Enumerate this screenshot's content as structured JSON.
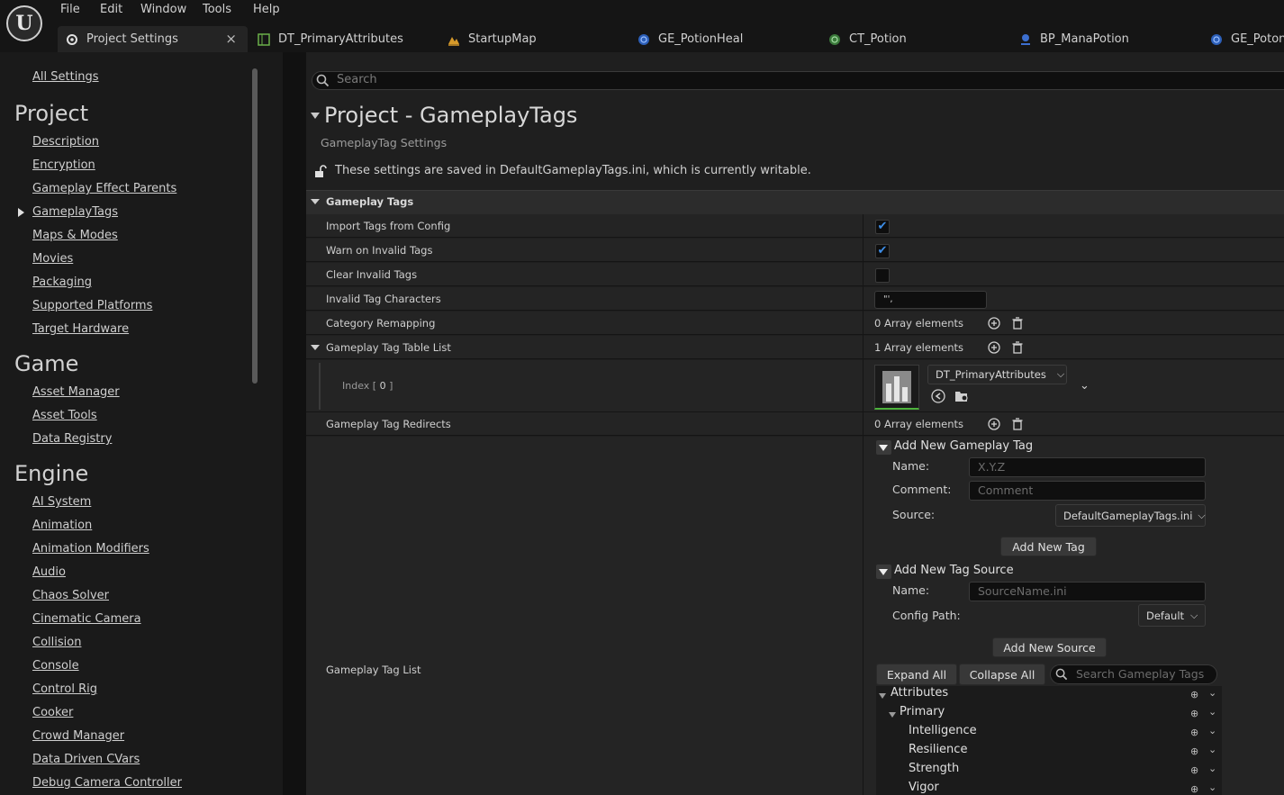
{
  "menu": [
    "File",
    "Edit",
    "Window",
    "Tools",
    "Help"
  ],
  "tabs": [
    {
      "label": "Project Settings",
      "icon": "settings-icon",
      "close": "×"
    },
    {
      "label": "DT_PrimaryAttributes",
      "icon": "data-table-icon"
    },
    {
      "label": "StartupMap",
      "icon": "level-icon"
    },
    {
      "label": "GE_PotionHeal",
      "icon": "blueprint-icon"
    },
    {
      "label": "CT_Potion",
      "icon": "curve-table-icon"
    },
    {
      "label": "BP_ManaPotion",
      "icon": "actor-icon"
    },
    {
      "label": "GE_Poton",
      "icon": "blueprint-icon"
    }
  ],
  "sidebar": {
    "all_settings": "All Settings",
    "project_heading": "Project",
    "project_items": [
      "Description",
      "Encryption",
      "Gameplay Effect Parents",
      "GameplayTags",
      "Maps & Modes",
      "Movies",
      "Packaging",
      "Supported Platforms",
      "Target Hardware"
    ],
    "game_heading": "Game",
    "game_items": [
      "Asset Manager",
      "Asset Tools",
      "Data Registry"
    ],
    "engine_heading": "Engine",
    "engine_items": [
      "AI System",
      "Animation",
      "Animation Modifiers",
      "Audio",
      "Chaos Solver",
      "Cinematic Camera",
      "Collision",
      "Console",
      "Control Rig",
      "Cooker",
      "Crowd Manager",
      "Data Driven CVars",
      "Debug Camera Controller"
    ]
  },
  "search": {
    "placeholder": "Search"
  },
  "page": {
    "title": "Project - GameplayTags",
    "subtitle": "GameplayTag Settings",
    "writable_notice": "These settings are saved in DefaultGameplayTags.ini, which is currently writable."
  },
  "section": {
    "title": "Gameplay Tags"
  },
  "properties": {
    "import_tags": {
      "label": "Import Tags from Config",
      "checked": true
    },
    "warn_invalid": {
      "label": "Warn on Invalid Tags",
      "checked": true
    },
    "clear_invalid": {
      "label": "Clear Invalid Tags",
      "checked": false
    },
    "invalid_chars": {
      "label": "Invalid Tag Characters",
      "value": "\"',"
    },
    "category_remap": {
      "label": "Category Remapping",
      "value": "0 Array elements"
    },
    "table_list": {
      "label": "Gameplay Tag Table List",
      "value": "1 Array elements"
    },
    "index0": {
      "label": "Index",
      "index": "0",
      "asset": "DT_PrimaryAttributes"
    },
    "redirects": {
      "label": "Gameplay Tag Redirects",
      "value": "0 Array elements"
    },
    "tag_list": {
      "label": "Gameplay Tag List"
    }
  },
  "add_tag": {
    "heading": "Add New Gameplay Tag",
    "name_label": "Name:",
    "name_placeholder": "X.Y.Z",
    "comment_label": "Comment:",
    "comment_placeholder": "Comment",
    "source_label": "Source:",
    "source_value": "DefaultGameplayTags.ini",
    "button": "Add New Tag"
  },
  "add_source": {
    "heading": "Add New Tag Source",
    "name_label": "Name:",
    "name_placeholder": "SourceName.ini",
    "config_label": "Config Path:",
    "config_value": "Default",
    "button": "Add New Source"
  },
  "tag_tree": {
    "expand_all": "Expand All",
    "collapse_all": "Collapse All",
    "search_placeholder": "Search Gameplay Tags",
    "items": [
      {
        "label": "Attributes",
        "depth": 0,
        "expanded": true
      },
      {
        "label": "Primary",
        "depth": 1,
        "expanded": true
      },
      {
        "label": "Intelligence",
        "depth": 2
      },
      {
        "label": "Resilience",
        "depth": 2
      },
      {
        "label": "Strength",
        "depth": 2
      },
      {
        "label": "Vigor",
        "depth": 2
      }
    ]
  },
  "colors": {
    "accent": "#3d8ee8",
    "checkbox": "#3d8ee8"
  }
}
